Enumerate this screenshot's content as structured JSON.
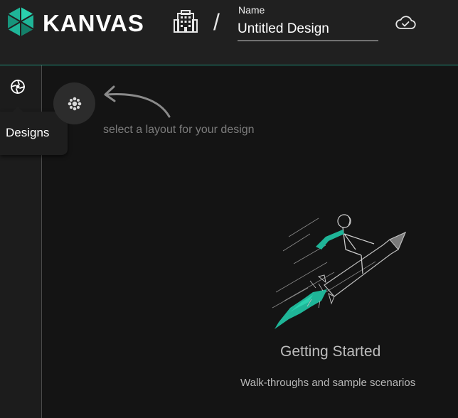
{
  "header": {
    "brand": "KANVAS",
    "separator": "/",
    "name_label": "Name",
    "name_value": "Untitled Design",
    "icons": {
      "logo": "kanvas-logo-icon",
      "building": "building-icon",
      "cloud": "cloud-check-icon"
    }
  },
  "sidebar": {
    "items": [
      {
        "icon": "designs-icon",
        "tooltip": "Designs"
      }
    ]
  },
  "main": {
    "layout_hint": "select a layout for your design",
    "empty_state": {
      "title": "Getting Started",
      "subtitle": "Walk-throughs and sample scenarios"
    }
  },
  "colors": {
    "accent": "#1fb598",
    "topbar_bg": "#202020",
    "canvas_bg": "#141414",
    "sidebar_bg": "#1c1c1c"
  }
}
